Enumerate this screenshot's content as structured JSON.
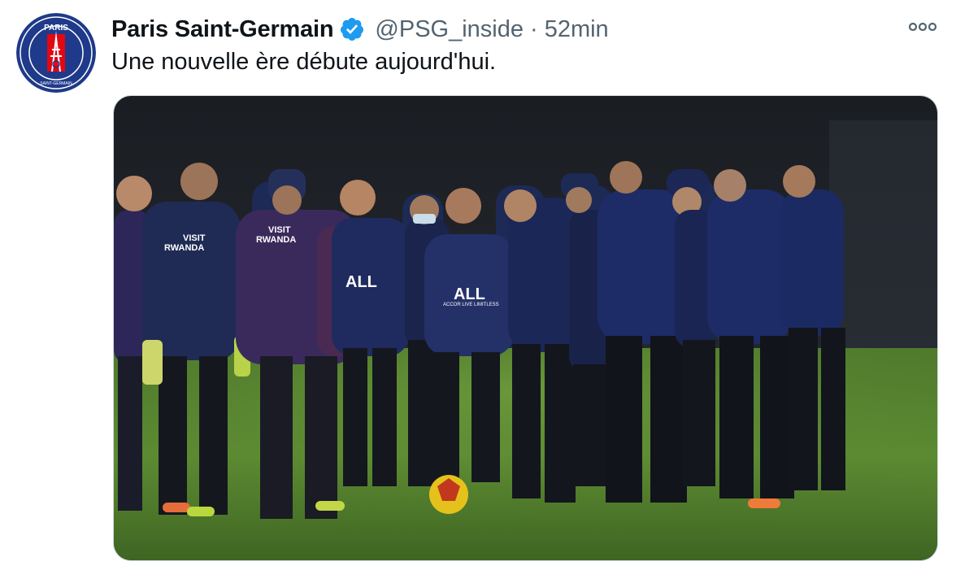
{
  "tweet": {
    "display_name": "Paris Saint-Germain",
    "handle": "@PSG_inside",
    "separator": "·",
    "time": "52min",
    "text": "Une nouvelle ère débute aujourd'hui.",
    "verified": true
  },
  "avatar": {
    "logo_top_text": "PARIS",
    "logo_ring_text": "SAINT-GERMAIN",
    "colors": {
      "navy": "#1f3a8a",
      "red": "#e30613",
      "white": "#ffffff"
    }
  },
  "media": {
    "shirt_sponsor": "VISIT RWANDA",
    "shirt_sponsor_line1": "VISIT",
    "shirt_sponsor_line2": "RWANDA",
    "front_sponsor": "ALL",
    "front_sponsor_sub": "ACCOR LIVE LIMITLESS"
  },
  "icons": {
    "verified": "verified-badge-icon",
    "more": "more-options-icon"
  },
  "colors": {
    "verified_blue": "#1d9bf0",
    "secondary_text": "#536471",
    "primary_text": "#0f1419"
  }
}
